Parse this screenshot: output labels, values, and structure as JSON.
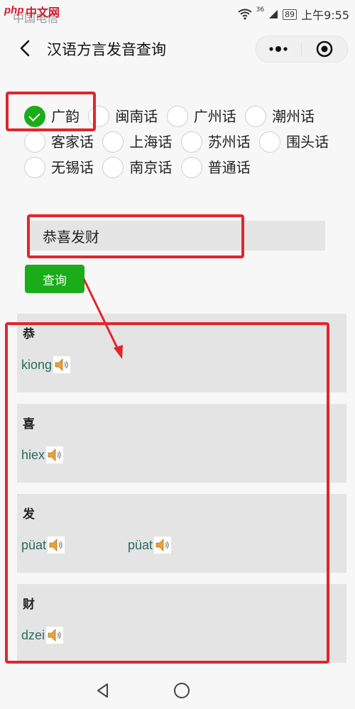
{
  "status_bar": {
    "carrier": "中国电信",
    "watermark_logo": "php",
    "watermark_text": "中文网",
    "network": "36",
    "battery": "89",
    "time": "上午9:55"
  },
  "header": {
    "title": "汉语方言发音查询",
    "more_icon": "more-dots-icon",
    "close_icon": "record-circle-icon"
  },
  "dialects": [
    {
      "label": "广韵",
      "checked": true
    },
    {
      "label": "闽南话",
      "checked": false
    },
    {
      "label": "广州话",
      "checked": false
    },
    {
      "label": "潮州话",
      "checked": false
    },
    {
      "label": "客家话",
      "checked": false
    },
    {
      "label": "上海话",
      "checked": false
    },
    {
      "label": "苏州话",
      "checked": false
    },
    {
      "label": "围头话",
      "checked": false
    },
    {
      "label": "无锡话",
      "checked": false
    },
    {
      "label": "南京话",
      "checked": false
    },
    {
      "label": "普通话",
      "checked": false
    }
  ],
  "search": {
    "value": "恭喜发财"
  },
  "query_button": {
    "label": "查询"
  },
  "results": [
    {
      "char": "恭",
      "readings": [
        "kiong"
      ]
    },
    {
      "char": "喜",
      "readings": [
        "hiex"
      ]
    },
    {
      "char": "发",
      "readings": [
        "püat",
        "püat"
      ]
    },
    {
      "char": "财",
      "readings": [
        "dzei"
      ]
    }
  ],
  "colors": {
    "accent_green": "#1aad19",
    "annotation_red": "#e0262c",
    "pronunciation_text": "#2b6b5a",
    "card_background": "#e4e4e4"
  }
}
